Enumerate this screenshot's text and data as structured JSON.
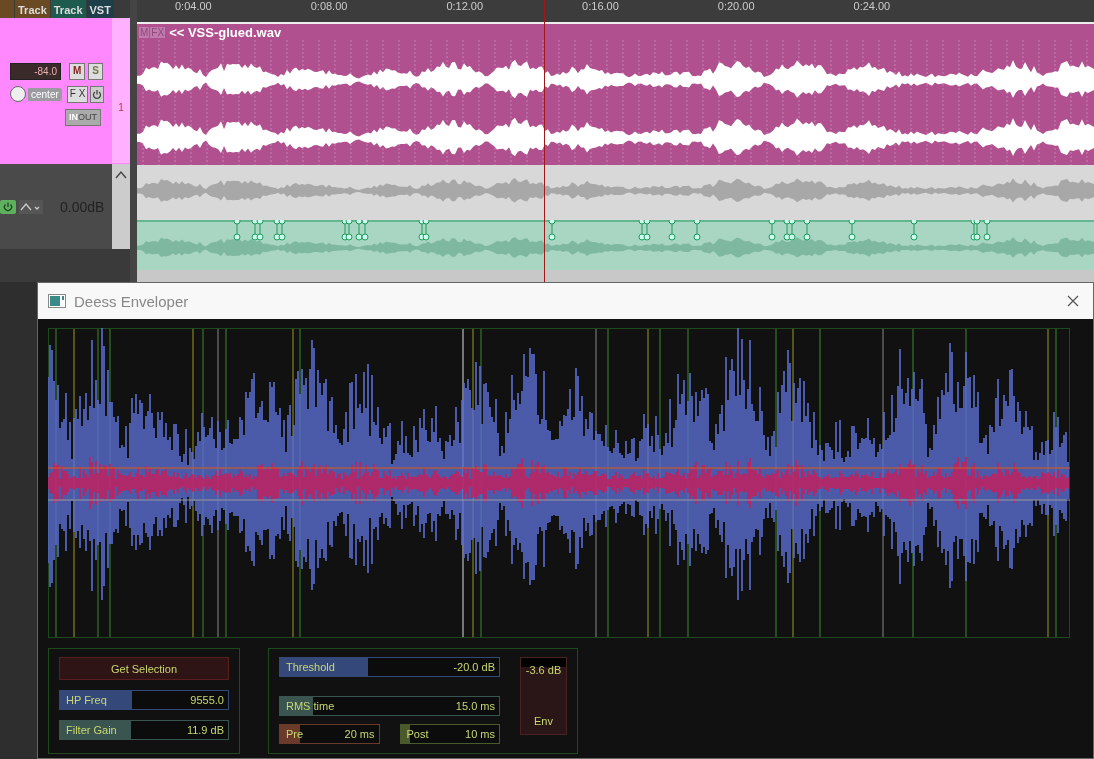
{
  "top_tabs": [
    {
      "label": "Track",
      "color": "#6a4a22"
    },
    {
      "label": "Track",
      "color": "#1f5a4e"
    },
    {
      "label": "VST",
      "color": "#1e3e4a"
    }
  ],
  "track": {
    "volume": "-84.0",
    "mute": "M",
    "solo": "S",
    "pan": "center",
    "fx": "F X",
    "input": "IN",
    "output": "OUT",
    "number": "1"
  },
  "envelope_lane": {
    "value": "0.00dB"
  },
  "timeline": {
    "ticks": [
      "0:04.00",
      "0:08.00",
      "0:12.00",
      "0:16.00",
      "0:20.00",
      "0:24.00"
    ]
  },
  "clip": {
    "mute": "M",
    "fx": "FX",
    "name": "<< VSS-glued.wav"
  },
  "plugin": {
    "title": "Deess Enveloper",
    "get_selection": "Get Selection",
    "left_sliders": [
      {
        "label": "HP Freq",
        "value": "9555.0",
        "level": 0.43,
        "color": "#34487a"
      },
      {
        "label": "Filter Gain",
        "value": "11.9 dB",
        "level": 0.42,
        "color": "#3a5450"
      }
    ],
    "threshold": {
      "label": "Threshold",
      "value": "-20.0 dB",
      "level": 0.4,
      "color": "#34487a"
    },
    "rms": {
      "label": "RMS time",
      "value": "15.0 ms",
      "level": 0.15,
      "color": "#3a5450"
    },
    "pre": {
      "label": "Pre",
      "value": "20 ms",
      "level": 0.2,
      "color": "#6a3a2a"
    },
    "post": {
      "label": "Post",
      "value": "10 ms",
      "level": 0.1,
      "color": "#4a5a2a"
    },
    "env_meter": {
      "reading": "-3.6 dB",
      "label": "Env",
      "level": 0.88
    }
  }
}
